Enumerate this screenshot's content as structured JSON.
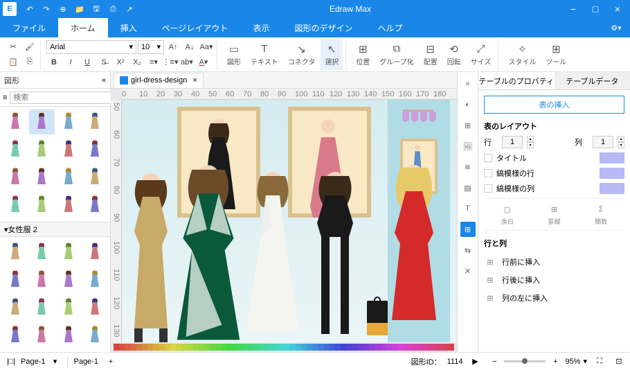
{
  "app": {
    "title": "Edraw Max"
  },
  "qat": [
    "↶",
    "↷",
    "⊕",
    "📁",
    "🖫",
    "⎙",
    "↗"
  ],
  "menu": {
    "tabs": [
      "ファイル",
      "ホーム",
      "挿入",
      "ページレイアウト",
      "表示",
      "図形のデザイン",
      "ヘルプ"
    ],
    "active": 1
  },
  "ribbon": {
    "font": {
      "name": "Arial",
      "size": "10"
    },
    "shapes": [
      {
        "lbl": "図形"
      },
      {
        "lbl": "テキスト"
      },
      {
        "lbl": "コネクタ"
      },
      {
        "lbl": "選択"
      }
    ],
    "arrange": [
      {
        "lbl": "位置"
      },
      {
        "lbl": "グループ化"
      },
      {
        "lbl": "配置"
      },
      {
        "lbl": "回転"
      },
      {
        "lbl": "サイズ"
      }
    ],
    "style": [
      {
        "lbl": "スタイル"
      },
      {
        "lbl": "ツール"
      }
    ]
  },
  "shapepane": {
    "title": "図形",
    "search_ph": "検索",
    "cat2": "女性服 2"
  },
  "doc": {
    "tab": "girl-dress-design"
  },
  "ruler_h": [
    0,
    10,
    20,
    30,
    40,
    50,
    60,
    70,
    80,
    90,
    100,
    110,
    120,
    130,
    140,
    150,
    160,
    170,
    180
  ],
  "ruler_v": [
    50,
    60,
    70,
    80,
    90,
    100,
    110,
    120,
    130
  ],
  "prop": {
    "tabs": [
      "テーブルのプロパティ",
      "テーブルデータ"
    ],
    "insert_btn": "表の挿入",
    "layout_hdr": "表のレイアウト",
    "row_lbl": "行",
    "row_val": "1",
    "col_lbl": "列",
    "col_val": "1",
    "chk1": "タイトル",
    "chk2": "縞模様の行",
    "chk3": "縞模様の列",
    "icons": [
      {
        "lbl": "余白"
      },
      {
        "lbl": "罫線"
      },
      {
        "lbl": "関数"
      }
    ],
    "rows_hdr": "行と列",
    "ins": [
      "行前に挿入",
      "行後に挿入",
      "列の左に挿入"
    ]
  },
  "status": {
    "page": "Page-1",
    "page2": "Page-1",
    "drawid_lbl": "図形ID：",
    "drawid": "1114",
    "zoom": "95%"
  },
  "colors": [
    "#000",
    "#444",
    "#888",
    "#ccc",
    "#fff",
    "#8b0000",
    "#f00",
    "#ff8c00",
    "#ffd700",
    "#9acd32",
    "#008000",
    "#00ced1",
    "#4169e1",
    "#00008b",
    "#8a2be2",
    "#ff1493",
    "#ffc0cb",
    "#f5deb3",
    "#a0522d",
    "#556b2f"
  ]
}
